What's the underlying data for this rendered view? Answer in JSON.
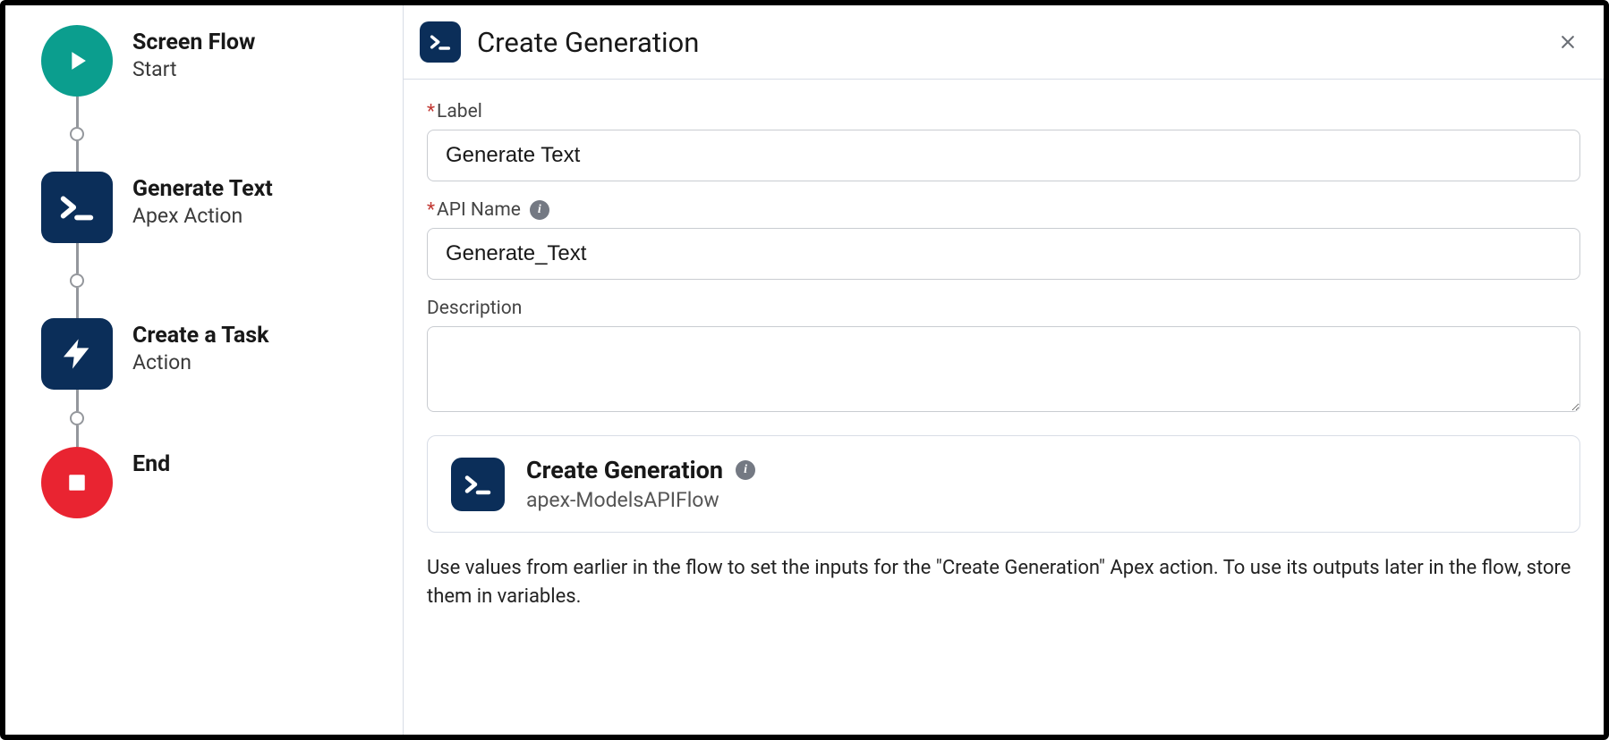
{
  "flow": {
    "nodes": [
      {
        "title": "Screen Flow",
        "subtitle": "Start"
      },
      {
        "title": "Generate Text",
        "subtitle": "Apex Action"
      },
      {
        "title": "Create a Task",
        "subtitle": "Action"
      },
      {
        "title": "End",
        "subtitle": ""
      }
    ]
  },
  "panel": {
    "title": "Create Generation",
    "fields": {
      "label_label": "Label",
      "label_value": "Generate Text",
      "api_name_label": "API Name",
      "api_name_value": "Generate_Text",
      "description_label": "Description",
      "description_value": ""
    },
    "action_card": {
      "title": "Create Generation",
      "subtitle": "apex-ModelsAPIFlow"
    },
    "help_text": "Use values from earlier in the flow to set the inputs for the \"Create Generation\" Apex action. To use its outputs later in the flow, store them in variables."
  },
  "colors": {
    "teal": "#0b9e8e",
    "navy": "#0b2e59",
    "red": "#e92431"
  }
}
